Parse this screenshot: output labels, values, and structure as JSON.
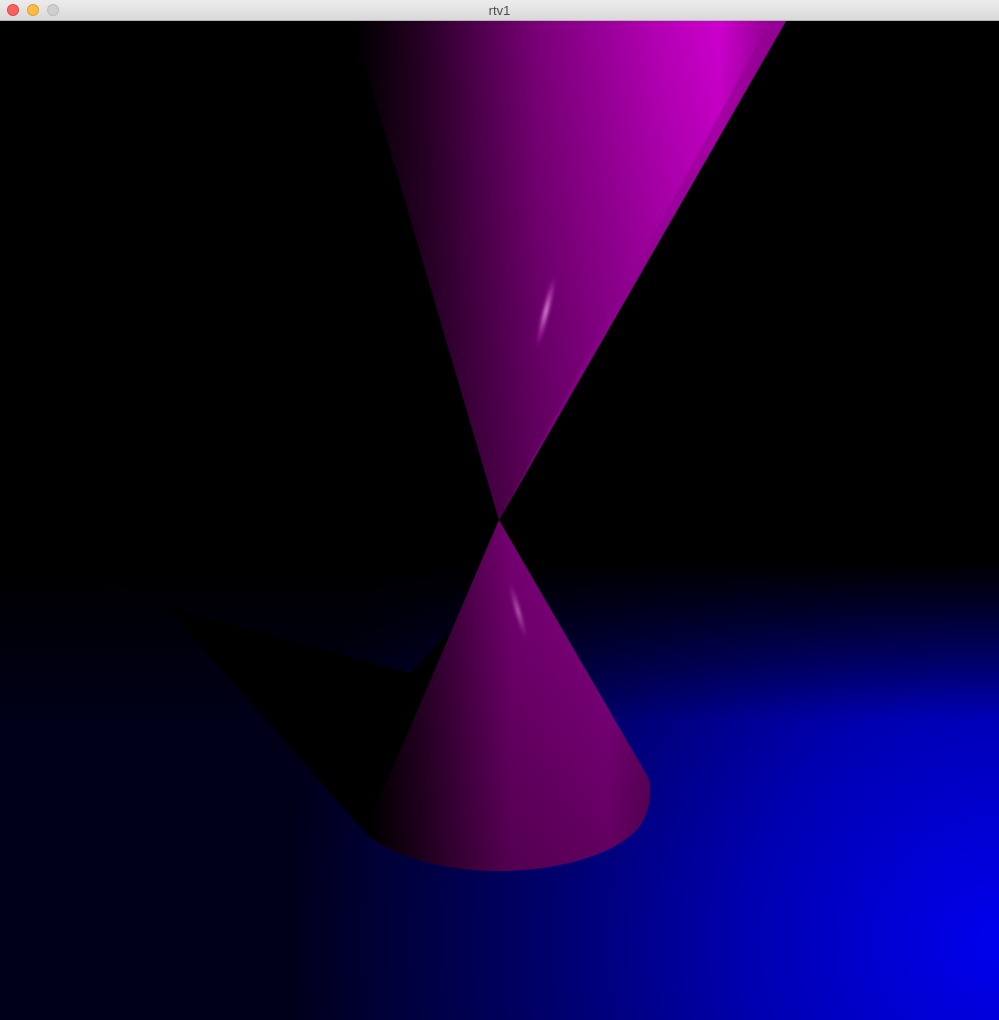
{
  "window": {
    "title": "rtv1"
  },
  "scene": {
    "description_colors": {
      "background": "#000000",
      "floor_far": "#000010",
      "floor_near": "#0000ee",
      "cone_bright": "#cc00cc",
      "cone_dark": "#2a0028",
      "specular": "#f0c8f0"
    },
    "objects": [
      "upper-cone",
      "lower-cone",
      "floor-plane",
      "cone-shadow",
      "specular-highlight"
    ]
  }
}
